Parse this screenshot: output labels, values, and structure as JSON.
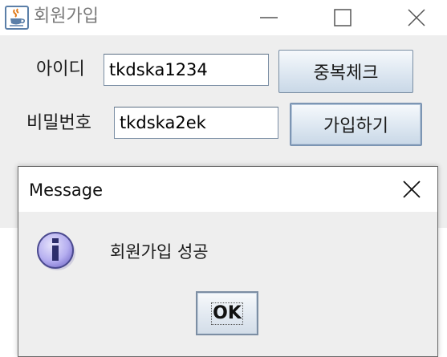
{
  "main_window": {
    "title": "회원가입",
    "icon": "java-cup-icon",
    "controls": {
      "minimize": "minimize-icon",
      "maximize": "maximize-icon",
      "close": "close-icon"
    }
  },
  "form": {
    "id_label": "아이디",
    "id_value": "tkdska1234",
    "check_button": "중복체크",
    "password_label": "비밀번호",
    "password_value": "tkdska2ek",
    "join_button": "가입하기"
  },
  "dialog": {
    "title": "Message",
    "icon": "information-icon",
    "message": "회원가입 성공",
    "ok_button": "OK",
    "close": "close-icon"
  }
}
